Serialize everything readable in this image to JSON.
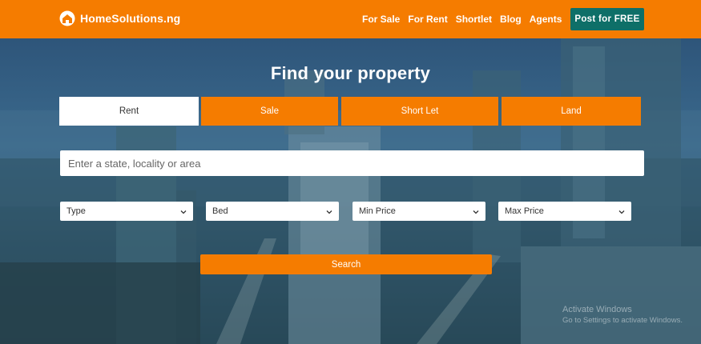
{
  "header": {
    "logo_text": "HomeSolutions.ng",
    "nav": [
      "For Sale",
      "For Rent",
      "Shortlet",
      "Blog",
      "Agents"
    ],
    "post_label": "Post for FREE"
  },
  "hero": {
    "title": "Find your property",
    "tabs": [
      {
        "label": "Rent",
        "active": true
      },
      {
        "label": "Sale",
        "active": false
      },
      {
        "label": "Short Let",
        "active": false
      },
      {
        "label": "Land",
        "active": false
      }
    ],
    "search": {
      "placeholder": "Enter a state, locality or area"
    },
    "filters": [
      "Type",
      "Bed",
      "Min Price",
      "Max Price"
    ],
    "search_button": "Search"
  },
  "watermark": {
    "line1": "Activate Windows",
    "line2": "Go to Settings to activate Windows."
  },
  "colors": {
    "accent": "#f57c00",
    "post_button": "#0e6f68"
  }
}
